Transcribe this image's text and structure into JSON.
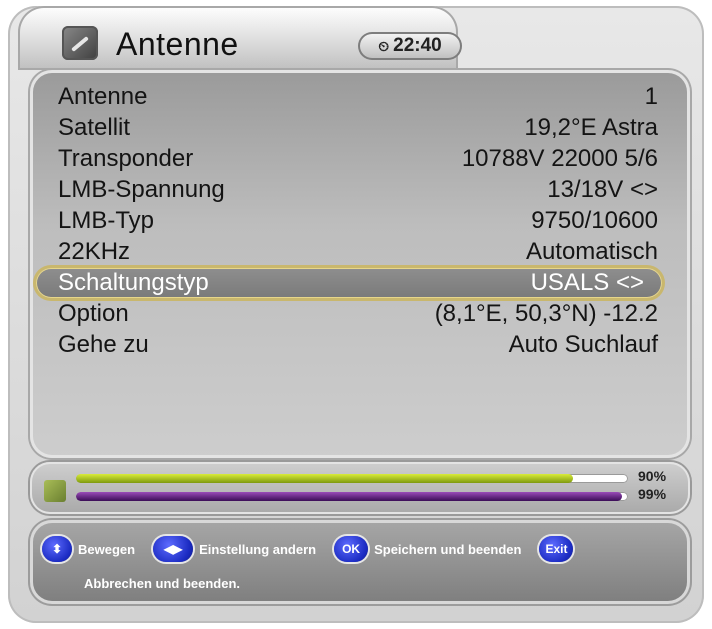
{
  "header": {
    "title": "Antenne",
    "time": "22:40",
    "time_icon": "clock-icon"
  },
  "menu": {
    "rows": [
      {
        "label": "Antenne",
        "value": "1"
      },
      {
        "label": "Satellit",
        "value": "19,2°E Astra"
      },
      {
        "label": "Transponder",
        "value": "10788V 22000 5/6"
      },
      {
        "label": "LMB-Spannung",
        "value": "13/18V <>"
      },
      {
        "label": "LMB-Typ",
        "value": "9750/10600"
      },
      {
        "label": "22KHz",
        "value": "Automatisch"
      },
      {
        "label": "Schaltungstyp",
        "value": "USALS <>",
        "selected": true
      },
      {
        "label": "Option",
        "value": "(8,1°E, 50,3°N) -12.2"
      },
      {
        "label": "Gehe zu",
        "value": "Auto Suchlauf"
      }
    ]
  },
  "signal": {
    "strength_label": "90%",
    "strength": 0.9,
    "quality_label": "99%",
    "quality": 0.99
  },
  "help": {
    "move_label": "Bewegen",
    "setting_label": "Einstellung andern",
    "ok_key": "OK",
    "save_label": "Speichern und beenden",
    "exit_key": "Exit",
    "cancel_label": "Abbrechen und beenden."
  },
  "colors": {
    "selection_border": "#c9b76d",
    "strength_bar": "#b8d12a",
    "quality_bar": "#5a1f7a",
    "key_blue": "#1b2bc2"
  }
}
